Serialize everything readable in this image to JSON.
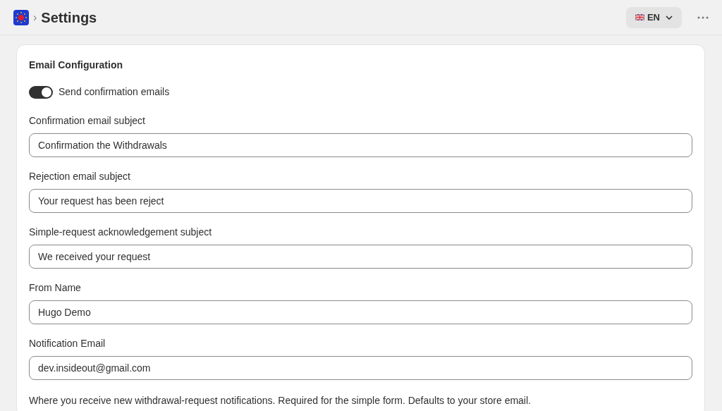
{
  "header": {
    "title": "Settings",
    "breadcrumb_separator": "›",
    "language": "EN"
  },
  "card": {
    "title": "Email Configuration",
    "toggle": {
      "label": "Send confirmation emails",
      "on": true
    },
    "fields": [
      {
        "label": "Confirmation email subject",
        "value": "Confirmation the Withdrawals"
      },
      {
        "label": "Rejection email subject",
        "value": "Your request has been reject"
      },
      {
        "label": "Simple-request acknowledgement subject",
        "value": "We received your request"
      },
      {
        "label": "From Name",
        "value": "Hugo Demo"
      },
      {
        "label": "Notification Email",
        "value": "dev.insideout@gmail.com"
      }
    ],
    "help_text": "Where you receive new withdrawal-request notifications. Required for the simple form. Defaults to your store email."
  }
}
